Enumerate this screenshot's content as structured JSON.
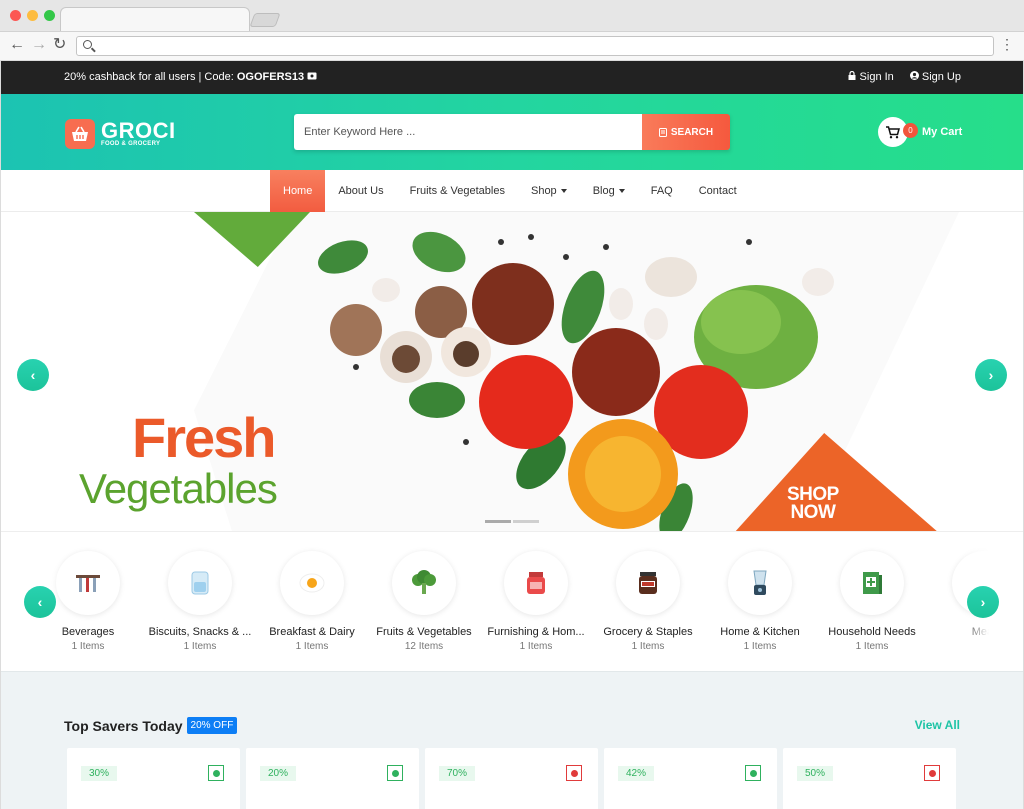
{
  "topbar": {
    "promo_text": "20% cashback for all users | Code:",
    "promo_code": "OGOFERS13",
    "sign_in": "Sign In",
    "sign_up": "Sign Up"
  },
  "brand": {
    "name": "GROCI",
    "tagline": "FOOD & GROCERY"
  },
  "search": {
    "placeholder": "Enter Keyword Here ...",
    "button": "SEARCH"
  },
  "cart": {
    "label": "My Cart",
    "count": "0"
  },
  "nav": {
    "items": [
      {
        "label": "Home"
      },
      {
        "label": "About Us"
      },
      {
        "label": "Fruits & Vegetables"
      },
      {
        "label": "Shop"
      },
      {
        "label": "Blog"
      },
      {
        "label": "FAQ"
      },
      {
        "label": "Contact"
      }
    ]
  },
  "hero": {
    "headline_1": "Fresh",
    "headline_2": "Vegetables",
    "cta_line_1": "SHOP",
    "cta_line_2": "NOW",
    "prev": "‹",
    "next": "›"
  },
  "categories": {
    "items": [
      {
        "name": "Beverages",
        "count": "1 Items",
        "icon": "beverages-icon"
      },
      {
        "name": "Biscuits, Snacks & ...",
        "count": "1 Items",
        "icon": "jar-icon"
      },
      {
        "name": "Breakfast & Dairy",
        "count": "1 Items",
        "icon": "egg-icon"
      },
      {
        "name": "Fruits & Vegetables",
        "count": "12 Items",
        "icon": "broccoli-icon"
      },
      {
        "name": "Furnishing & Hom...",
        "count": "1 Items",
        "icon": "jam-jar-icon"
      },
      {
        "name": "Grocery & Staples",
        "count": "1 Items",
        "icon": "spread-jar-icon"
      },
      {
        "name": "Home & Kitchen",
        "count": "1 Items",
        "icon": "blender-icon"
      },
      {
        "name": "Household Needs",
        "count": "1 Items",
        "icon": "box-icon"
      },
      {
        "name": "Meat",
        "count": "",
        "icon": "meat-icon"
      }
    ]
  },
  "savers": {
    "title": "Top Savers Today",
    "badge": "20% OFF",
    "view_all": "View All",
    "products": [
      {
        "discount": "30%",
        "type": "veg"
      },
      {
        "discount": "20%",
        "type": "veg"
      },
      {
        "discount": "70%",
        "type": "non-veg"
      },
      {
        "discount": "42%",
        "type": "veg"
      },
      {
        "discount": "50%",
        "type": "non-veg"
      }
    ]
  },
  "colors": {
    "accent_teal": "#1ec4a6",
    "accent_orange": "#f25c40",
    "badge_blue": "#0d7ef5"
  }
}
